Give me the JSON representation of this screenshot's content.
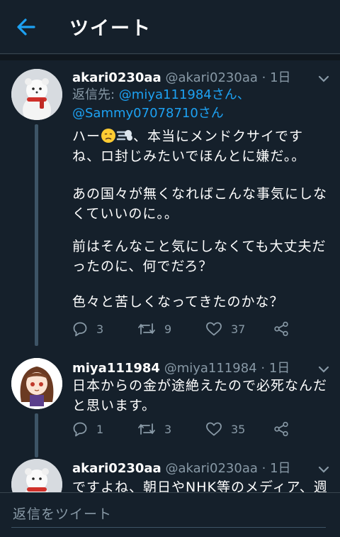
{
  "header": {
    "title": "ツイート"
  },
  "tweets": [
    {
      "name": "akari0230aa",
      "handle": "@akari0230aa",
      "dot": "·",
      "time": "1日",
      "reply_prefix": "返信先: ",
      "reply_users": [
        "@miya111984さん、",
        "@Sammy07078710さん"
      ],
      "text_first_prefix": "ハー",
      "text_first_suffix": "、本当にメンドクサイです",
      "lines": [
        "ね、ロ封じみたいでほんとに嫌だ。。",
        "あの国々が無くなればこんな事気にしな",
        "くていいのに。。",
        "前はそんなこと気にしなくても大丈夫だ",
        "ったのに、何でだろ？",
        "色々と苦しくなってきたのかな？"
      ],
      "replies": "3",
      "retweets": "9",
      "likes": "37"
    },
    {
      "name": "miya111984",
      "handle": "@miya111984",
      "dot": "·",
      "time": "1日",
      "lines": [
        "日本からの金が途絶えたので必死なんだ",
        "と思います。"
      ],
      "replies": "1",
      "retweets": "3",
      "likes": "35"
    },
    {
      "name": "akari0230aa",
      "handle": "@akari0230aa",
      "dot": "·",
      "time": "1日",
      "lines": [
        "ですよね、朝日やNHK等のメディア、週"
      ]
    }
  ],
  "reply_bar": {
    "placeholder": "返信をツイート"
  },
  "icons": [
    "back-arrow-icon",
    "chevron-down-icon",
    "reply-icon",
    "retweet-icon",
    "like-icon",
    "share-icon",
    "disappointed-face-emoji",
    "dash-emoji",
    "snowman-avatar",
    "anime-girl-avatar"
  ],
  "colors": {
    "background": "#15202b",
    "accent": "#1da1f2",
    "muted": "#8899a6",
    "divider": "#38444d"
  }
}
